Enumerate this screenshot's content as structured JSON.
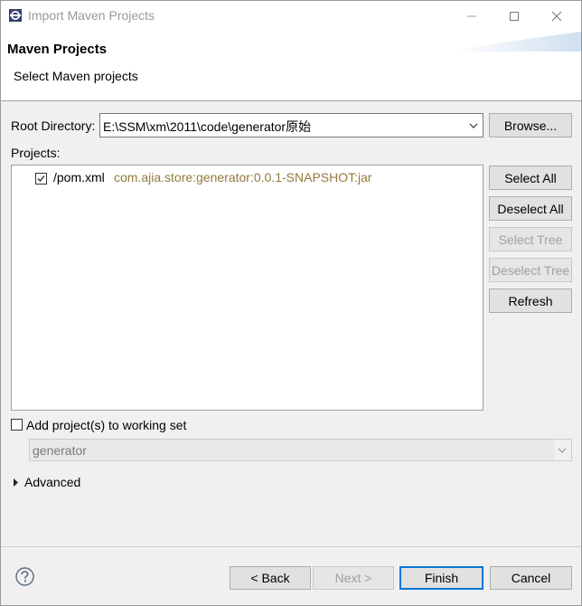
{
  "window": {
    "title": "Import Maven Projects"
  },
  "header": {
    "title": "Maven Projects",
    "subtitle": "Select Maven projects"
  },
  "root": {
    "label": "Root Directory:",
    "value": "E:\\SSM\\xm\\2011\\code\\generator原始",
    "browse_label": "Browse..."
  },
  "projects": {
    "label": "Projects:",
    "items": [
      {
        "name": "/pom.xml",
        "coordinates": "com.ajia.store:generator:0.0.1-SNAPSHOT:jar",
        "checked": true
      }
    ]
  },
  "side_buttons": {
    "select_all": "Select All",
    "deselect_all": "Deselect All",
    "select_tree": "Select Tree",
    "deselect_tree": "Deselect Tree",
    "refresh": "Refresh"
  },
  "working_set": {
    "label": "Add project(s) to working set",
    "checked": false,
    "value": "generator"
  },
  "advanced": {
    "label": "Advanced"
  },
  "footer": {
    "back": "< Back",
    "next": "Next >",
    "finish": "Finish",
    "cancel": "Cancel"
  },
  "colors": {
    "accent": "#0078d7",
    "coordinates_text": "#937a3c",
    "disabled_text": "#a0a0a0"
  },
  "icons": {
    "app": "eclipse-app-icon",
    "help": "help-icon",
    "expand": "caret-right-icon",
    "dropdown": "chevron-down-icon"
  }
}
